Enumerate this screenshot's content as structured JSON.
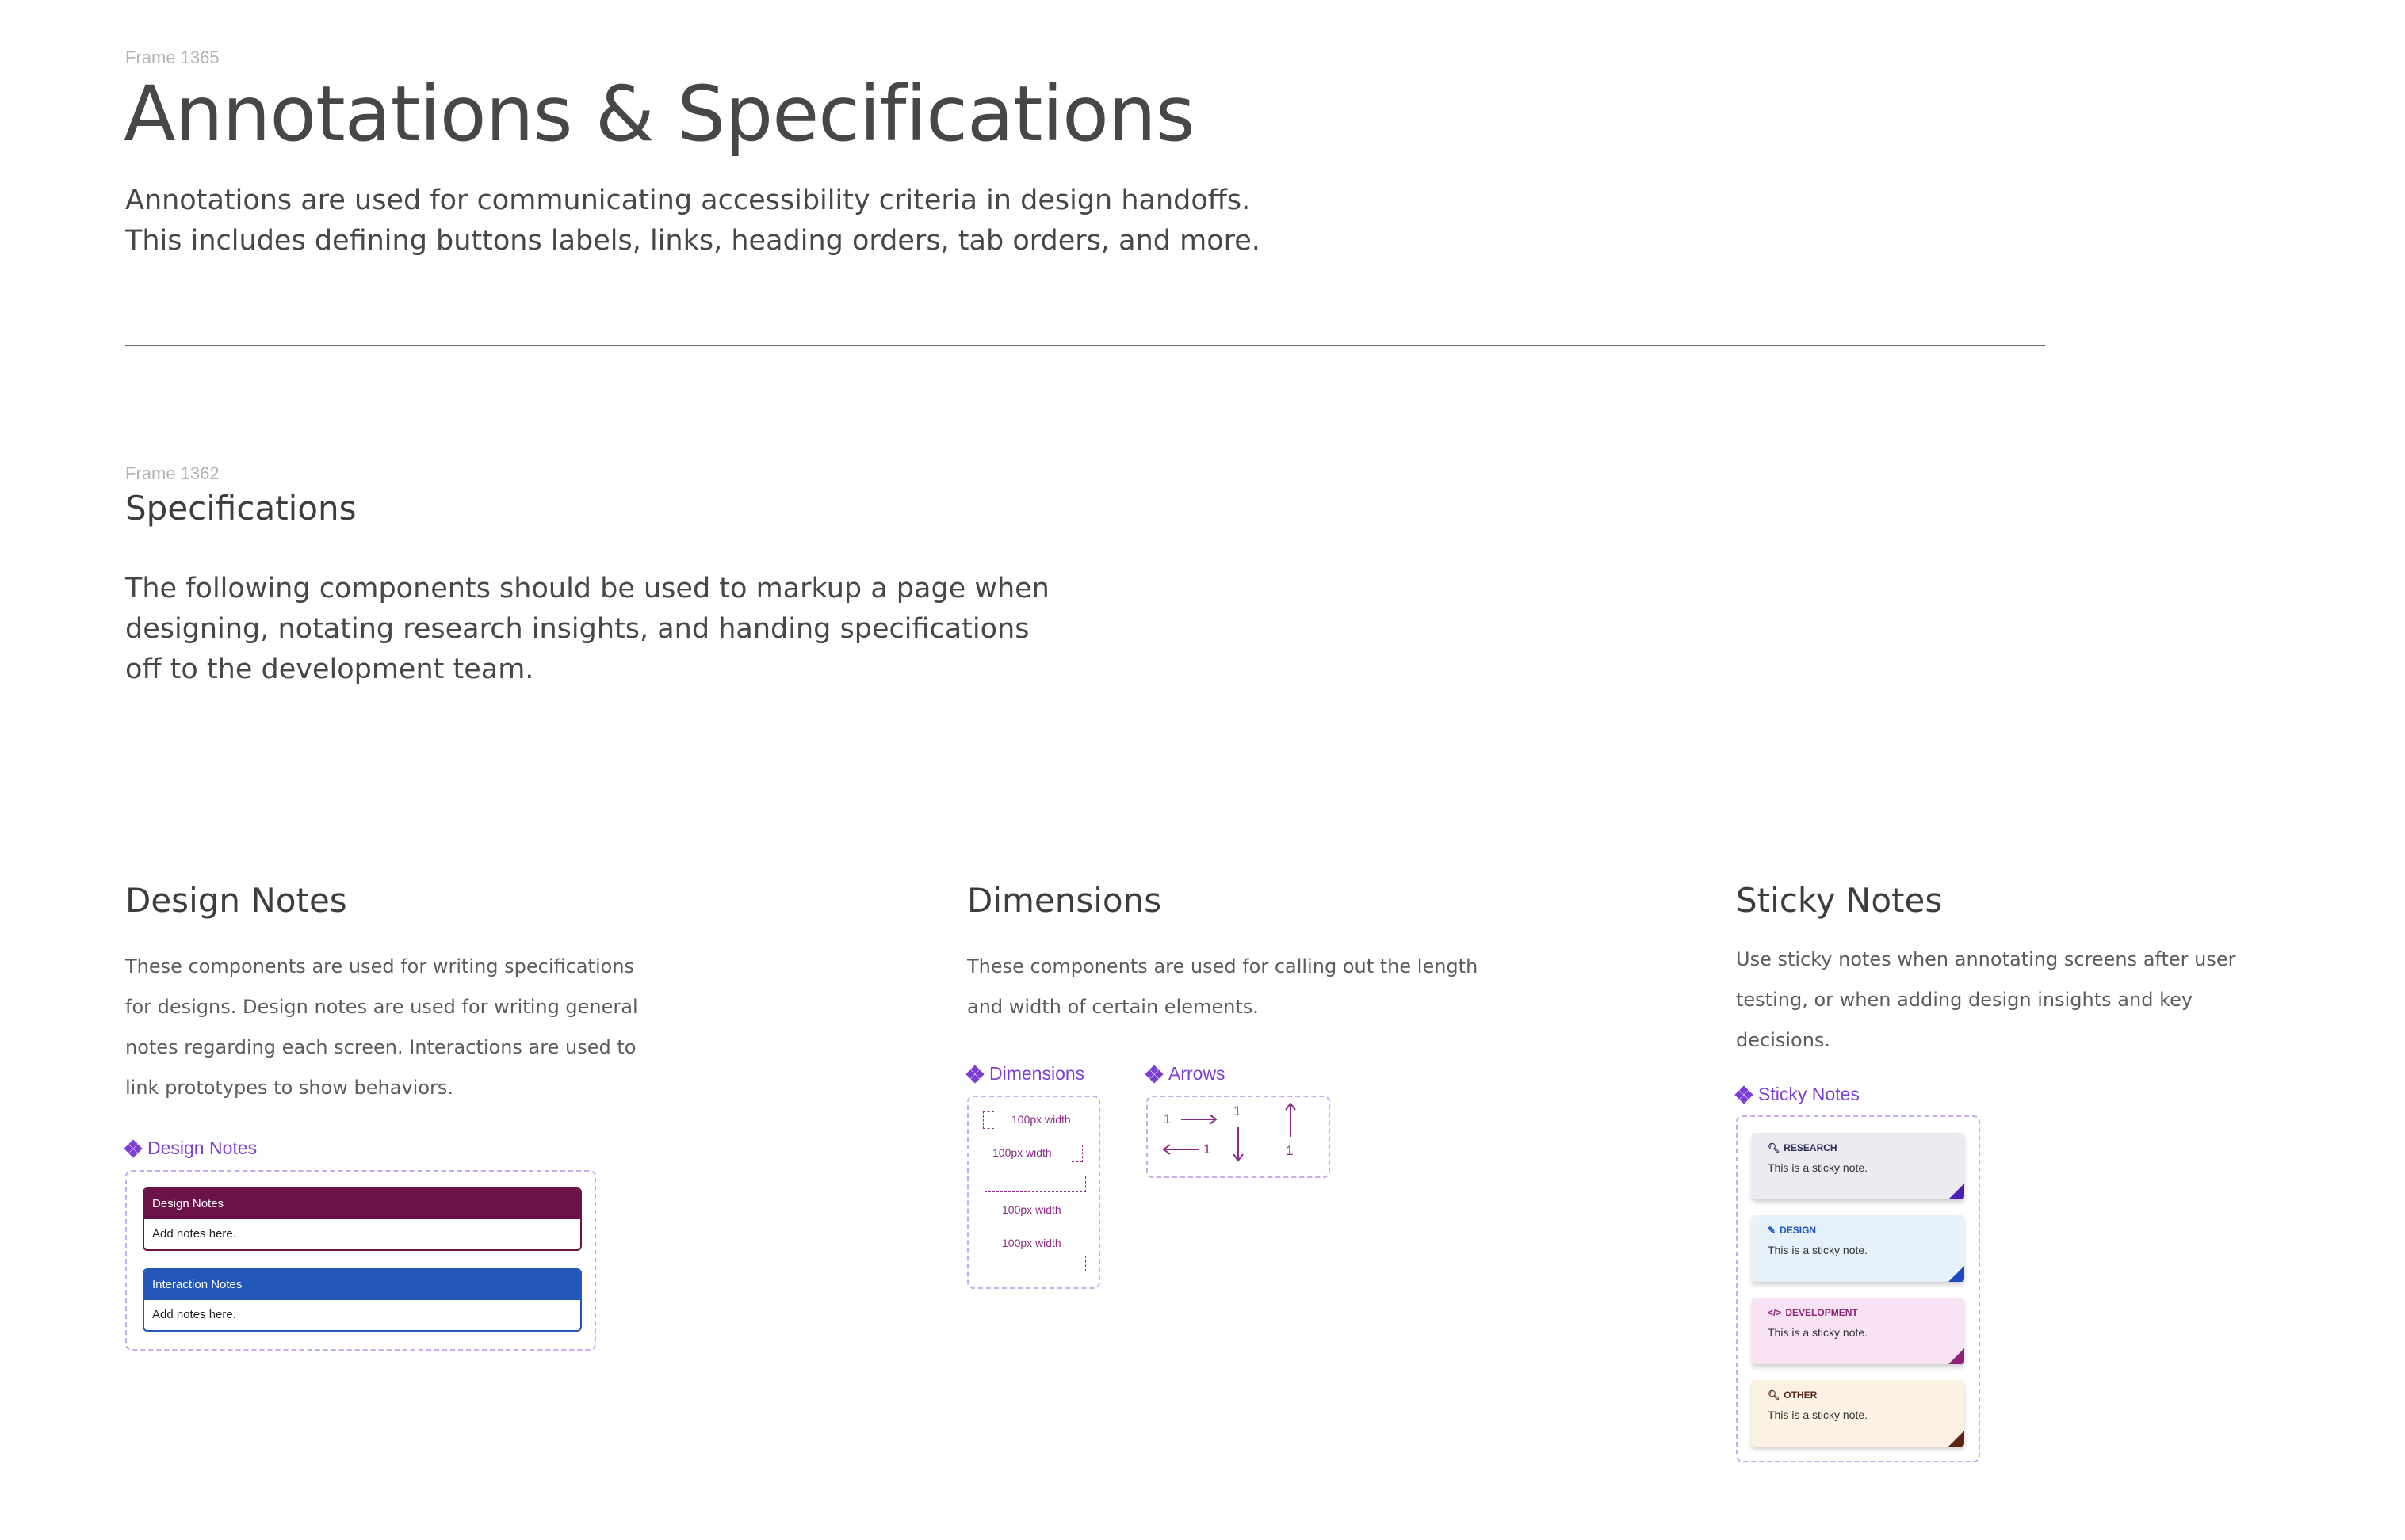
{
  "header": {
    "frame_label": "Frame 1365",
    "title": "Annotations & Specifications",
    "lead_line1": "Annotations are used for communicating accessibility criteria in design handoffs.",
    "lead_line2": "This includes defining buttons labels, links, heading orders, tab orders, and more."
  },
  "specs": {
    "frame_label": "Frame 1362",
    "title": "Specifications",
    "body_line1": "The following components should be used to markup a page when",
    "body_line2": "designing, notating research insights, and handing specifications",
    "body_line3": "off to the development team."
  },
  "design_notes": {
    "title": "Design Notes",
    "desc": [
      "These components are used for writing specifications",
      "for designs. Design notes are used for writing general",
      "notes regarding each screen. Interactions are used to",
      "link prototypes to show behaviors."
    ],
    "component_label": "Design Notes",
    "cards": [
      {
        "header": "Design Notes",
        "body": "Add notes here.",
        "color": "#6b1248"
      },
      {
        "header": "Interaction Notes",
        "body": "Add notes here.",
        "color": "#2257b8"
      }
    ]
  },
  "dimensions": {
    "title": "Dimensions",
    "desc": [
      "These components are used for calling out the length",
      "and width of certain elements."
    ],
    "dimensions_label": "Dimensions",
    "arrows_label": "Arrows",
    "width_labels": [
      "100px width",
      "100px width",
      "100px width",
      "100px width"
    ],
    "arrow_numbers": [
      "1",
      "1",
      "1",
      "1"
    ]
  },
  "sticky_notes": {
    "title": "Sticky Notes",
    "desc": [
      "Use sticky notes when annotating screens after user",
      "testing, or when adding design insights and key",
      "decisions."
    ],
    "component_label": "Sticky Notes",
    "notes": [
      {
        "tag": "RESEARCH",
        "text": "This is a sticky note.",
        "icon": "search-icon",
        "bg": "#ecebf2",
        "tag_color": "#2a2a55",
        "fold": "#4a1fb8"
      },
      {
        "tag": "DESIGN",
        "text": "This is a sticky note.",
        "icon": "pencil-icon",
        "bg": "#e6f1fb",
        "tag_color": "#1f56b5",
        "fold": "#1f48c4"
      },
      {
        "tag": "DEVELOPMENT",
        "text": "This is a sticky note.",
        "icon": "code-icon",
        "bg": "#f8e3f4",
        "tag_color": "#8e2378",
        "fold": "#8e2378"
      },
      {
        "tag": "OTHER",
        "text": "This is a sticky note.",
        "icon": "search-icon",
        "bg": "#fdf1e4",
        "tag_color": "#5a2a1a",
        "fold": "#5a2515"
      }
    ]
  }
}
